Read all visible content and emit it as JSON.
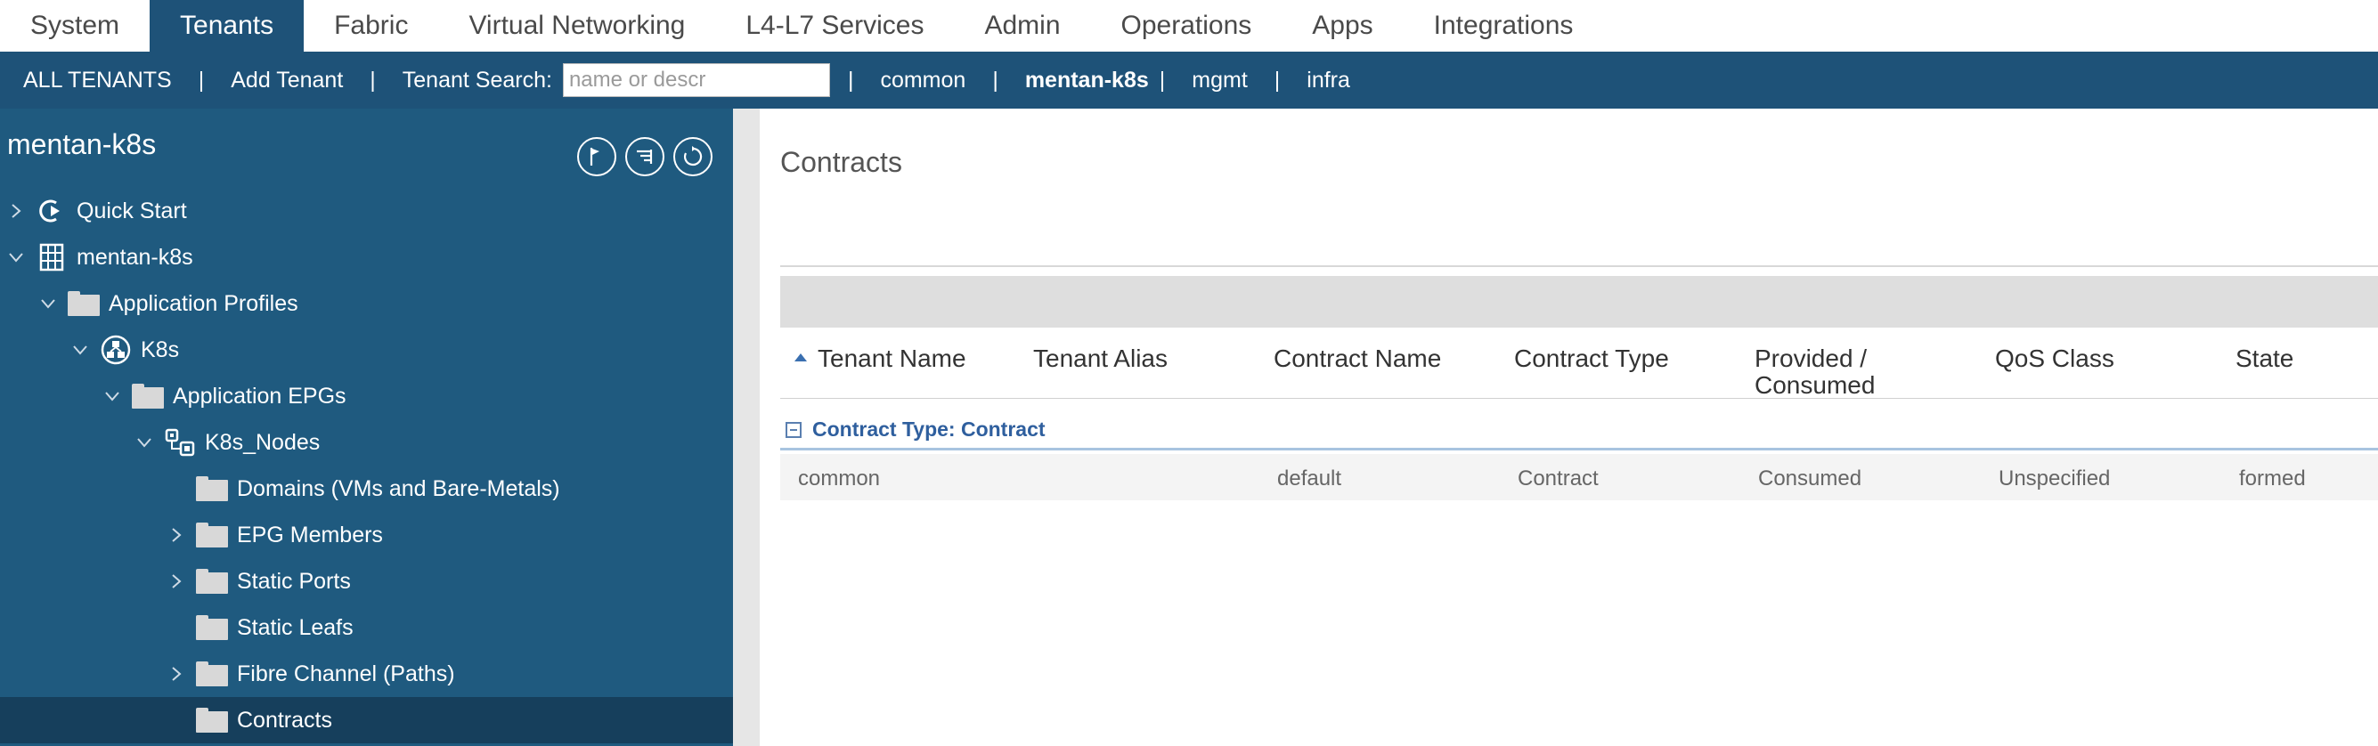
{
  "topnav": {
    "tabs": [
      "System",
      "Tenants",
      "Fabric",
      "Virtual Networking",
      "L4-L7 Services",
      "Admin",
      "Operations",
      "Apps",
      "Integrations"
    ],
    "active": "Tenants"
  },
  "subnav": {
    "all_tenants": "ALL TENANTS",
    "add_tenant": "Add Tenant",
    "search_label": "Tenant Search:",
    "search_placeholder": "name or descr",
    "tenants": [
      "common",
      "mentan-k8s",
      "mgmt",
      "infra"
    ],
    "current_tenant": "mentan-k8s"
  },
  "sidebar": {
    "title": "mentan-k8s",
    "tools": [
      "flag-icon",
      "list-filter-icon",
      "refresh-icon"
    ],
    "tree": [
      {
        "label": "Quick Start",
        "icon": "quick-start-icon",
        "chevron": "right"
      },
      {
        "label": "mentan-k8s",
        "icon": "tenant-grid-icon",
        "chevron": "down"
      },
      {
        "label": "Application Profiles",
        "icon": "folder-icon",
        "chevron": "down"
      },
      {
        "label": "K8s",
        "icon": "app-profile-icon",
        "chevron": "down"
      },
      {
        "label": "Application EPGs",
        "icon": "folder-icon",
        "chevron": "down"
      },
      {
        "label": "K8s_Nodes",
        "icon": "epg-icon",
        "chevron": "down"
      },
      {
        "label": "Domains (VMs and Bare-Metals)",
        "icon": "folder-icon",
        "chevron": "none"
      },
      {
        "label": "EPG Members",
        "icon": "folder-icon",
        "chevron": "right"
      },
      {
        "label": "Static Ports",
        "icon": "folder-icon",
        "chevron": "right"
      },
      {
        "label": "Static Leafs",
        "icon": "folder-icon",
        "chevron": "none"
      },
      {
        "label": "Fibre Channel (Paths)",
        "icon": "folder-icon",
        "chevron": "right"
      },
      {
        "label": "Contracts",
        "icon": "folder-icon",
        "chevron": "none",
        "selected": true
      }
    ]
  },
  "main": {
    "title": "Contracts",
    "columns": [
      "Tenant Name",
      "Tenant Alias",
      "Contract Name",
      "Contract Type",
      "Provided / Consumed",
      "QoS Class",
      "State"
    ],
    "columns_wrapped": {
      "provided_line1": "Provided /",
      "provided_line2": "Consumed"
    },
    "sort_column": "Tenant Name",
    "group_label": "Contract Type: Contract",
    "rows": [
      {
        "tenant_name": "common",
        "tenant_alias": "",
        "contract_name": "default",
        "contract_type": "Contract",
        "provided_consumed": "Consumed",
        "qos_class": "Unspecified",
        "state": "formed"
      }
    ]
  },
  "colors": {
    "nav_blue": "#1e5278",
    "sidebar_blue": "#1f5a7f",
    "selected_row": "#163f5c",
    "group_label": "#2f5f9e"
  }
}
